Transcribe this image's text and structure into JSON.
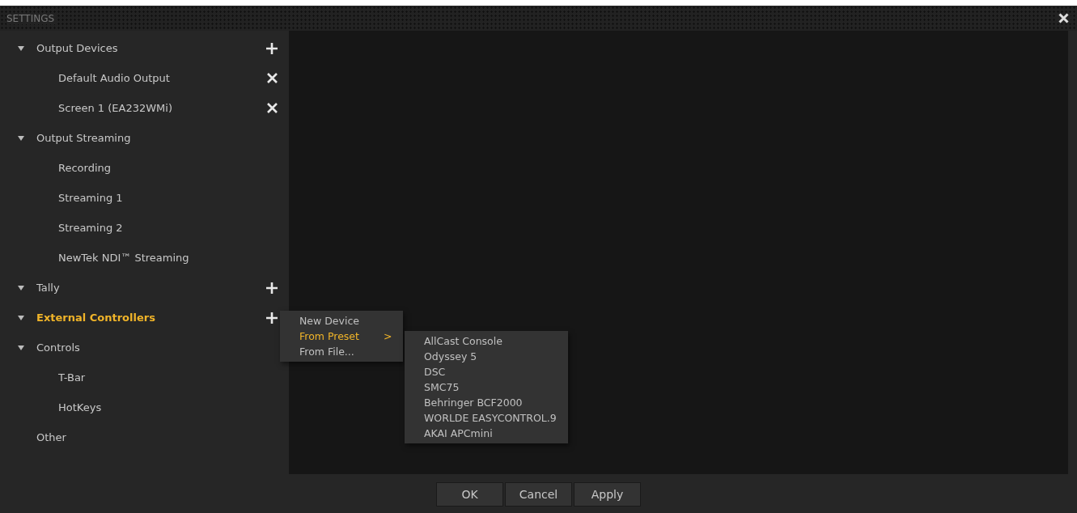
{
  "window": {
    "title": "SETTINGS"
  },
  "tree": [
    {
      "label": "Output Devices",
      "expanded": true,
      "selected": false,
      "add_button": true,
      "children": [
        {
          "label": "Default Audio Output",
          "selected": false,
          "remove_button": true
        },
        {
          "label": "Screen 1 (EA232WMi)",
          "selected": false,
          "remove_button": true
        }
      ]
    },
    {
      "label": "Output Streaming",
      "expanded": true,
      "selected": false,
      "children": [
        {
          "label": "Recording",
          "selected": false
        },
        {
          "label": "Streaming 1",
          "selected": false
        },
        {
          "label": "Streaming 2",
          "selected": false
        },
        {
          "label": "NewTek NDI™ Streaming",
          "selected": false
        }
      ]
    },
    {
      "label": "Tally",
      "expanded": true,
      "selected": false,
      "add_button": true
    },
    {
      "label": "External Controllers",
      "expanded": true,
      "selected": true,
      "add_button": true
    },
    {
      "label": "Controls",
      "expanded": true,
      "selected": false,
      "children": [
        {
          "label": "T-Bar",
          "selected": false
        },
        {
          "label": "HotKeys",
          "selected": false
        }
      ]
    },
    {
      "label": "Other",
      "selected": false
    }
  ],
  "context_menu": {
    "items": [
      {
        "label": "New Device",
        "selected": false
      },
      {
        "label": "From Preset",
        "selected": true,
        "submenu_arrow": ">"
      },
      {
        "label": "From File...",
        "selected": false
      }
    ],
    "submenu": [
      "AllCast Console",
      "Odyssey 5",
      "DSC",
      "SMC75",
      "Behringer BCF2000",
      "WORLDE EASYCONTROL.9",
      "AKAI APCmini"
    ]
  },
  "buttons": [
    "OK",
    "Cancel",
    "Apply"
  ]
}
